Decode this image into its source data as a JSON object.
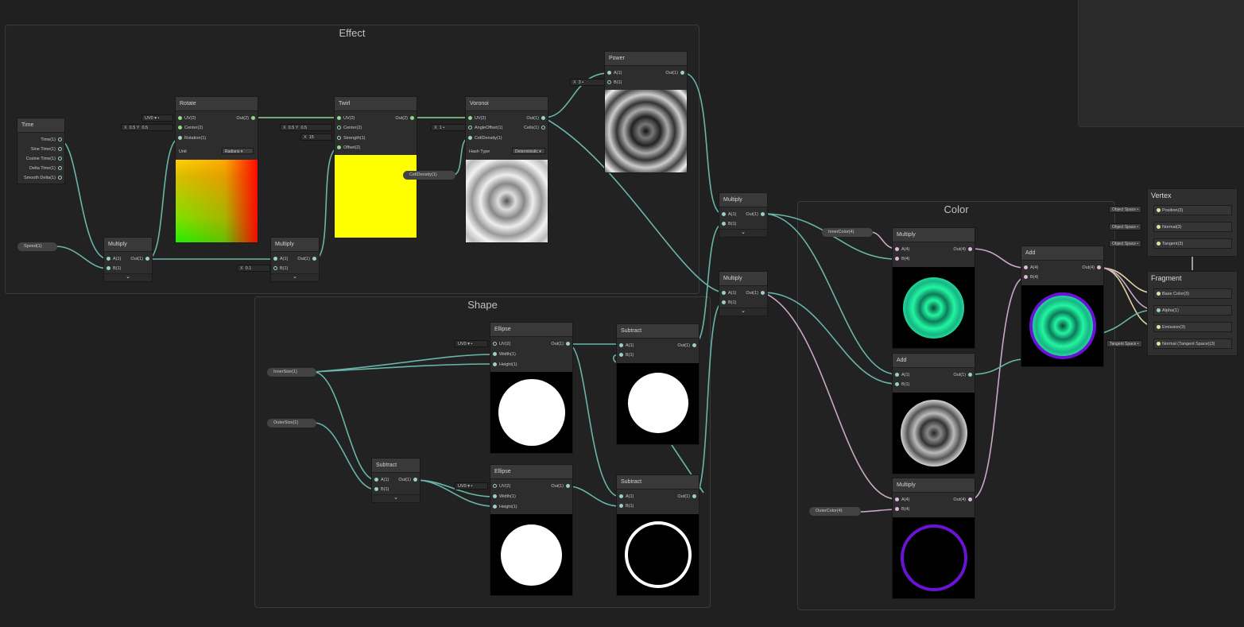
{
  "groups": {
    "effect": "Effect",
    "shape": "Shape",
    "color": "Color"
  },
  "nodes": {
    "time": {
      "title": "Time",
      "outs": [
        "Time(1)",
        "Sine Time(1)",
        "Cosine Time(1)",
        "Delta Time(1)",
        "Smooth Delta(1)"
      ]
    },
    "multiply1": {
      "title": "Multiply",
      "ins": [
        "A(1)",
        "B(1)"
      ],
      "out": "Out(1)"
    },
    "rotate": {
      "title": "Rotate",
      "ins": [
        "UV(2)",
        "Center(2)",
        "Rotation(1)"
      ],
      "out": "Out(2)",
      "unit_label": "Unit",
      "unit_value": "Radians",
      "uv_field": "UV0",
      "center_x": "0.5",
      "center_y": "0.5"
    },
    "multiply2": {
      "title": "Multiply",
      "ins": [
        "A(1)",
        "B(1)"
      ],
      "out": "Out(1)",
      "b_value": "0.1"
    },
    "twirl": {
      "title": "Twirl",
      "ins": [
        "UV(2)",
        "Center(2)",
        "Strength(1)",
        "Offset(2)"
      ],
      "out": "Out(2)",
      "center_x": "0.5",
      "center_y": "0.5",
      "strength": "15"
    },
    "voronoi": {
      "title": "Voronoi",
      "ins": [
        "UV(2)",
        "AngleOffset(1)",
        "CellDensity(1)"
      ],
      "outs": [
        "Out(1)",
        "Cells(1)"
      ],
      "hash_label": "Hash Type",
      "hash_value": "Deterministic",
      "angle_offset": "1"
    },
    "power": {
      "title": "Power",
      "ins": [
        "A(1)",
        "B(1)"
      ],
      "out": "Out(1)",
      "b_value": "3"
    },
    "multiply3": {
      "title": "Multiply",
      "ins": [
        "A(1)",
        "B(1)"
      ],
      "out": "Out(1)"
    },
    "multiply4": {
      "title": "Multiply",
      "ins": [
        "A(1)",
        "B(1)"
      ],
      "out": "Out(1)"
    },
    "ellipse1": {
      "title": "Ellipse",
      "ins": [
        "UV(2)",
        "Width(1)",
        "Height(1)"
      ],
      "out": "Out(1)",
      "uv_field": "UV0"
    },
    "ellipse2": {
      "title": "Ellipse",
      "ins": [
        "UV(2)",
        "Width(1)",
        "Height(1)"
      ],
      "out": "Out(1)",
      "uv_field": "UV0"
    },
    "subtract1": {
      "title": "Subtract",
      "ins": [
        "A(1)",
        "B(1)"
      ],
      "out": "Out(1)"
    },
    "subtract2": {
      "title": "Subtract",
      "ins": [
        "A(1)",
        "B(1)"
      ],
      "out": "Out(1)"
    },
    "subtract3": {
      "title": "Subtract",
      "ins": [
        "A(1)",
        "B(1)"
      ],
      "out": "Out(1)"
    },
    "multiply_color1": {
      "title": "Multiply",
      "ins": [
        "A(4)",
        "B(4)"
      ],
      "out": "Out(4)"
    },
    "add_color": {
      "title": "Add",
      "ins": [
        "A(1)",
        "B(1)"
      ],
      "out": "Out(1)"
    },
    "multiply_color2": {
      "title": "Multiply",
      "ins": [
        "A(4)",
        "B(4)"
      ],
      "out": "Out(4)"
    },
    "add_final": {
      "title": "Add",
      "ins": [
        "A(4)",
        "B(4)"
      ],
      "out": "Out(4)"
    }
  },
  "properties": {
    "speed": "Speed(1)",
    "cell_density": "CellDensity(1)",
    "inner_size": "InnerSize(1)",
    "outer_size": "OuterSize(1)",
    "inner_color": "InnerColor(4)",
    "outer_color": "OuterColor(4)"
  },
  "master": {
    "vertex_title": "Vertex",
    "vertex_slots": [
      "Position(3)",
      "Normal(3)",
      "Tangent(3)"
    ],
    "vertex_space": "Object Space",
    "fragment_title": "Fragment",
    "fragment_slots": [
      "Base Color(3)",
      "Alpha(1)",
      "Emission(3)",
      "Normal (Tangent Space)(3)"
    ],
    "tangent_space": "Tangent Space"
  },
  "labels": {
    "x": "X",
    "y": "Y"
  },
  "colors": {
    "wire_float": "#69b5aa",
    "wire_vec2": "#8fd889",
    "wire_vec4": "#c9a7c7",
    "wire_vec3": "#d9d59f",
    "accent_green": "#22f5a0",
    "accent_purple": "#6a12d6"
  }
}
